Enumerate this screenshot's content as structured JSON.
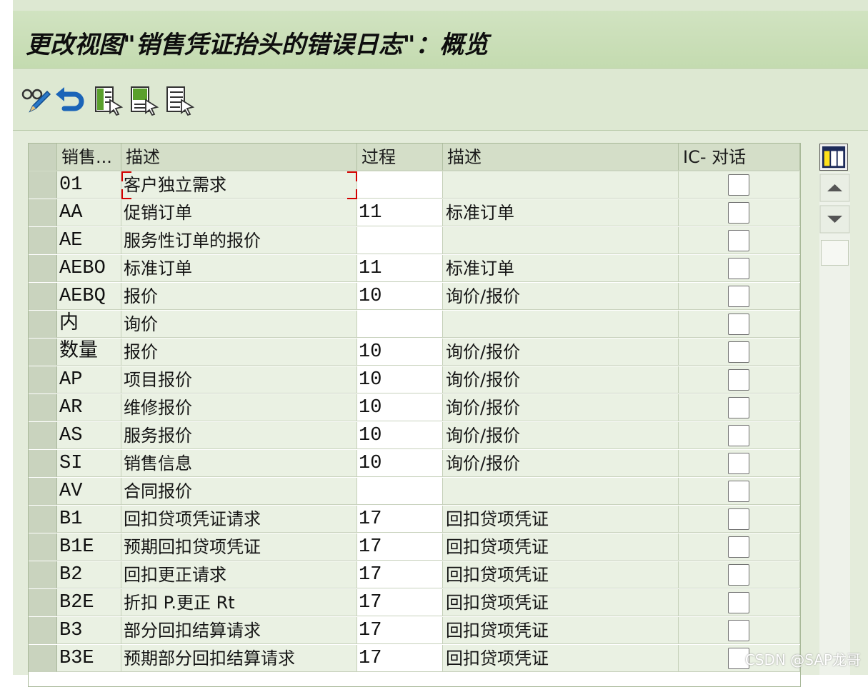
{
  "window": {
    "title": "更改视图\"销售凭证抬头的错误日志\"：概览"
  },
  "toolbar": {
    "buttons": [
      {
        "name": "display-change-icon"
      },
      {
        "name": "undo-icon"
      },
      {
        "name": "select-all-icon"
      },
      {
        "name": "select-block-icon"
      },
      {
        "name": "deselect-all-icon"
      }
    ]
  },
  "table": {
    "columns": [
      "销售...",
      "描述",
      "过程",
      "描述",
      "IC- 对话"
    ],
    "rows": [
      {
        "code": "01",
        "desc": "客户独立需求",
        "proc": "",
        "proc_desc": ""
      },
      {
        "code": "AA",
        "desc": "促销订单",
        "proc": "11",
        "proc_desc": "标准订单"
      },
      {
        "code": "AE",
        "desc": "服务性订单的报价",
        "proc": "",
        "proc_desc": ""
      },
      {
        "code": "AEBO",
        "desc": "标准订单",
        "proc": "11",
        "proc_desc": "标准订单"
      },
      {
        "code": "AEBQ",
        "desc": "报价",
        "proc": "10",
        "proc_desc": "询价/报价"
      },
      {
        "code": "内",
        "desc": "询价",
        "proc": "",
        "proc_desc": ""
      },
      {
        "code": "数量",
        "desc": "报价",
        "proc": "10",
        "proc_desc": "询价/报价"
      },
      {
        "code": "AP",
        "desc": "项目报价",
        "proc": "10",
        "proc_desc": "询价/报价"
      },
      {
        "code": "AR",
        "desc": "维修报价",
        "proc": "10",
        "proc_desc": "询价/报价"
      },
      {
        "code": "AS",
        "desc": "服务报价",
        "proc": "10",
        "proc_desc": "询价/报价"
      },
      {
        "code": "SI",
        "desc": "销售信息",
        "proc": "10",
        "proc_desc": "询价/报价"
      },
      {
        "code": "AV",
        "desc": "合同报价",
        "proc": "",
        "proc_desc": ""
      },
      {
        "code": "B1",
        "desc": "回扣贷项凭证请求",
        "proc": "17",
        "proc_desc": "回扣贷项凭证"
      },
      {
        "code": "B1E",
        "desc": "预期回扣贷项凭证",
        "proc": "17",
        "proc_desc": "回扣贷项凭证"
      },
      {
        "code": "B2",
        "desc": "回扣更正请求",
        "proc": "17",
        "proc_desc": "回扣贷项凭证"
      },
      {
        "code": "B2E",
        "desc": "折扣 P.更正 Rt",
        "proc": "17",
        "proc_desc": "回扣贷项凭证"
      },
      {
        "code": "B3",
        "desc": "部分回扣结算请求",
        "proc": "17",
        "proc_desc": "回扣贷项凭证"
      },
      {
        "code": "B3E",
        "desc": "预期部分回扣结算请求",
        "proc": "17",
        "proc_desc": "回扣贷项凭证"
      }
    ]
  },
  "colors": {
    "title_bg": "#c8ddb5",
    "row_bg": "#eaf1e3",
    "header_bg": "#d4dec8",
    "focus": "#d40000"
  },
  "watermark": "CSDN @SAP龙哥"
}
